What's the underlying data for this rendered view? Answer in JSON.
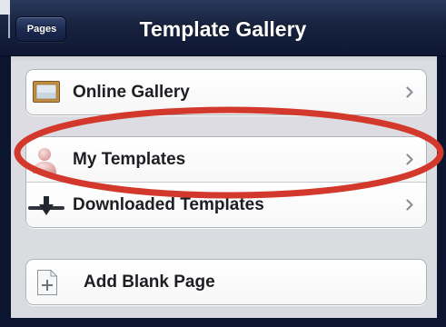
{
  "nav": {
    "back_label": "Pages",
    "title": "Template Gallery"
  },
  "groups": [
    {
      "items": [
        {
          "label": "Online Gallery",
          "icon": "picture-frame-icon",
          "chevron": true
        }
      ]
    },
    {
      "items": [
        {
          "label": "My Templates",
          "icon": "person-icon",
          "chevron": true,
          "highlighted": true
        },
        {
          "label": "Downloaded Templates",
          "icon": "download-icon",
          "chevron": true
        }
      ]
    },
    {
      "items": [
        {
          "label": "Add Blank Page",
          "icon": "add-page-icon",
          "chevron": false
        }
      ]
    }
  ],
  "colors": {
    "nav_bar": "#17223f",
    "panel_background": "#dadbe0",
    "label_text": "#1c1e22",
    "highlight_ellipse": "#d2392c"
  }
}
